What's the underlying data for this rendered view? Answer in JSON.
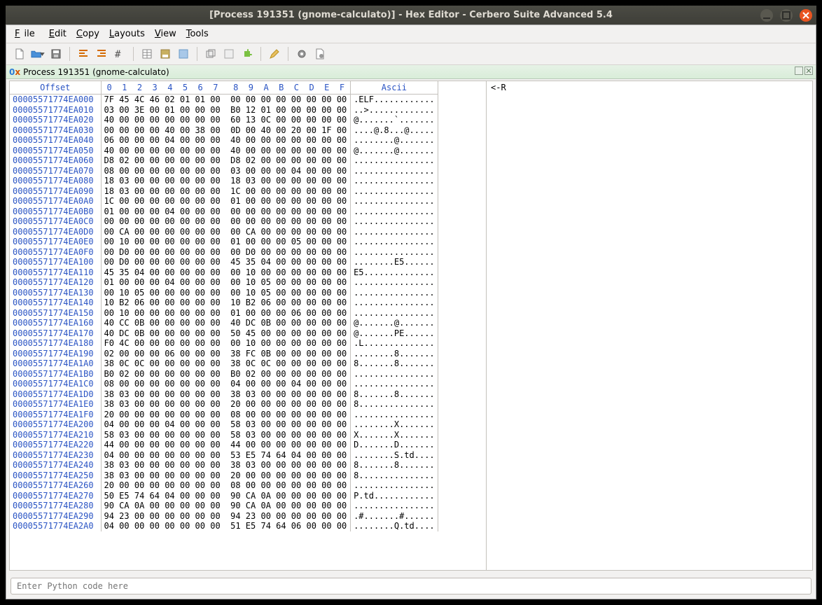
{
  "window": {
    "title": "[Process 191351 (gnome-calculato)] - Hex Editor - Cerbero Suite Advanced 5.4"
  },
  "menu": {
    "file": "File",
    "edit": "Edit",
    "copy": "Copy",
    "layouts": "Layouts",
    "view": "View",
    "tools": "Tools"
  },
  "tab": {
    "prefix_0": "0",
    "prefix_x": "x",
    "label": "Process 191351 (gnome-calculato)"
  },
  "hex": {
    "header_offset": "Offset",
    "header_bytes": "0  1  2  3  4  5  6  7   8  9  A  B  C  D  E  F",
    "header_ascii": "Ascii",
    "rows": [
      {
        "o": "00005571774EA000",
        "b": "7F 45 4C 46 02 01 01 00  00 00 00 00 00 00 00 00",
        "a": ".ELF............"
      },
      {
        "o": "00005571774EA010",
        "b": "03 00 3E 00 01 00 00 00  B0 12 01 00 00 00 00 00",
        "a": "..>............."
      },
      {
        "o": "00005571774EA020",
        "b": "40 00 00 00 00 00 00 00  60 13 0C 00 00 00 00 00",
        "a": "@.......`......."
      },
      {
        "o": "00005571774EA030",
        "b": "00 00 00 00 40 00 38 00  0D 00 40 00 20 00 1F 00",
        "a": "....@.8...@....."
      },
      {
        "o": "00005571774EA040",
        "b": "06 00 00 00 04 00 00 00  40 00 00 00 00 00 00 00",
        "a": "........@......."
      },
      {
        "o": "00005571774EA050",
        "b": "40 00 00 00 00 00 00 00  40 00 00 00 00 00 00 00",
        "a": "@.......@......."
      },
      {
        "o": "00005571774EA060",
        "b": "D8 02 00 00 00 00 00 00  D8 02 00 00 00 00 00 00",
        "a": "................"
      },
      {
        "o": "00005571774EA070",
        "b": "08 00 00 00 00 00 00 00  03 00 00 00 04 00 00 00",
        "a": "................"
      },
      {
        "o": "00005571774EA080",
        "b": "18 03 00 00 00 00 00 00  18 03 00 00 00 00 00 00",
        "a": "................"
      },
      {
        "o": "00005571774EA090",
        "b": "18 03 00 00 00 00 00 00  1C 00 00 00 00 00 00 00",
        "a": "................"
      },
      {
        "o": "00005571774EA0A0",
        "b": "1C 00 00 00 00 00 00 00  01 00 00 00 00 00 00 00",
        "a": "................"
      },
      {
        "o": "00005571774EA0B0",
        "b": "01 00 00 00 04 00 00 00  00 00 00 00 00 00 00 00",
        "a": "................"
      },
      {
        "o": "00005571774EA0C0",
        "b": "00 00 00 00 00 00 00 00  00 00 00 00 00 00 00 00",
        "a": "................"
      },
      {
        "o": "00005571774EA0D0",
        "b": "00 CA 00 00 00 00 00 00  00 CA 00 00 00 00 00 00",
        "a": "................"
      },
      {
        "o": "00005571774EA0E0",
        "b": "00 10 00 00 00 00 00 00  01 00 00 00 05 00 00 00",
        "a": "................"
      },
      {
        "o": "00005571774EA0F0",
        "b": "00 D0 00 00 00 00 00 00  00 D0 00 00 00 00 00 00",
        "a": "................"
      },
      {
        "o": "00005571774EA100",
        "b": "00 D0 00 00 00 00 00 00  45 35 04 00 00 00 00 00",
        "a": "........E5......"
      },
      {
        "o": "00005571774EA110",
        "b": "45 35 04 00 00 00 00 00  00 10 00 00 00 00 00 00",
        "a": "E5.............."
      },
      {
        "o": "00005571774EA120",
        "b": "01 00 00 00 04 00 00 00  00 10 05 00 00 00 00 00",
        "a": "................"
      },
      {
        "o": "00005571774EA130",
        "b": "00 10 05 00 00 00 00 00  00 10 05 00 00 00 00 00",
        "a": "................"
      },
      {
        "o": "00005571774EA140",
        "b": "10 B2 06 00 00 00 00 00  10 B2 06 00 00 00 00 00",
        "a": "................"
      },
      {
        "o": "00005571774EA150",
        "b": "00 10 00 00 00 00 00 00  01 00 00 00 06 00 00 00",
        "a": "................"
      },
      {
        "o": "00005571774EA160",
        "b": "40 CC 0B 00 00 00 00 00  40 DC 0B 00 00 00 00 00",
        "a": "@.......@......."
      },
      {
        "o": "00005571774EA170",
        "b": "40 DC 0B 00 00 00 00 00  50 45 00 00 00 00 00 00",
        "a": "@.......PE......"
      },
      {
        "o": "00005571774EA180",
        "b": "F0 4C 00 00 00 00 00 00  00 10 00 00 00 00 00 00",
        "a": ".L.............."
      },
      {
        "o": "00005571774EA190",
        "b": "02 00 00 00 06 00 00 00  38 FC 0B 00 00 00 00 00",
        "a": "........8......."
      },
      {
        "o": "00005571774EA1A0",
        "b": "38 0C 0C 00 00 00 00 00  38 0C 0C 00 00 00 00 00",
        "a": "8.......8......."
      },
      {
        "o": "00005571774EA1B0",
        "b": "B0 02 00 00 00 00 00 00  B0 02 00 00 00 00 00 00",
        "a": "................"
      },
      {
        "o": "00005571774EA1C0",
        "b": "08 00 00 00 00 00 00 00  04 00 00 00 04 00 00 00",
        "a": "................"
      },
      {
        "o": "00005571774EA1D0",
        "b": "38 03 00 00 00 00 00 00  38 03 00 00 00 00 00 00",
        "a": "8.......8......."
      },
      {
        "o": "00005571774EA1E0",
        "b": "38 03 00 00 00 00 00 00  20 00 00 00 00 00 00 00",
        "a": "8..............."
      },
      {
        "o": "00005571774EA1F0",
        "b": "20 00 00 00 00 00 00 00  08 00 00 00 00 00 00 00",
        "a": "................"
      },
      {
        "o": "00005571774EA200",
        "b": "04 00 00 00 04 00 00 00  58 03 00 00 00 00 00 00",
        "a": "........X......."
      },
      {
        "o": "00005571774EA210",
        "b": "58 03 00 00 00 00 00 00  58 03 00 00 00 00 00 00",
        "a": "X.......X......."
      },
      {
        "o": "00005571774EA220",
        "b": "44 00 00 00 00 00 00 00  44 00 00 00 00 00 00 00",
        "a": "D.......D......."
      },
      {
        "o": "00005571774EA230",
        "b": "04 00 00 00 00 00 00 00  53 E5 74 64 04 00 00 00",
        "a": "........S.td...."
      },
      {
        "o": "00005571774EA240",
        "b": "38 03 00 00 00 00 00 00  38 03 00 00 00 00 00 00",
        "a": "8.......8......."
      },
      {
        "o": "00005571774EA250",
        "b": "38 03 00 00 00 00 00 00  20 00 00 00 00 00 00 00",
        "a": "8..............."
      },
      {
        "o": "00005571774EA260",
        "b": "20 00 00 00 00 00 00 00  08 00 00 00 00 00 00 00",
        "a": "................"
      },
      {
        "o": "00005571774EA270",
        "b": "50 E5 74 64 04 00 00 00  90 CA 0A 00 00 00 00 00",
        "a": "P.td............"
      },
      {
        "o": "00005571774EA280",
        "b": "90 CA 0A 00 00 00 00 00  90 CA 0A 00 00 00 00 00",
        "a": "................"
      },
      {
        "o": "00005571774EA290",
        "b": "94 23 00 00 00 00 00 00  94 23 00 00 00 00 00 00",
        "a": ".#.......#......"
      },
      {
        "o": "00005571774EA2A0",
        "b": "04 00 00 00 00 00 00 00  51 E5 74 64 06 00 00 00",
        "a": "........Q.td...."
      }
    ]
  },
  "right_pane": {
    "line1": "<-R"
  },
  "python_input": {
    "placeholder": "Enter Python code here"
  }
}
